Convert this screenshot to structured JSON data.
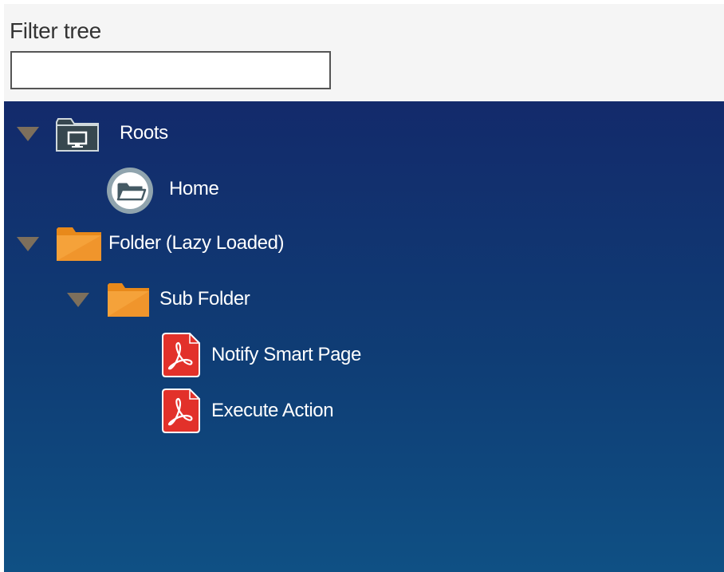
{
  "filter": {
    "label": "Filter tree",
    "value": "",
    "placeholder": ""
  },
  "tree": {
    "nodes": [
      {
        "label": "Roots",
        "icon": "computer-folder-icon",
        "expanded": true
      },
      {
        "label": "Home",
        "icon": "home-folder-icon"
      },
      {
        "label": "Folder (Lazy Loaded)",
        "icon": "folder-icon",
        "expanded": true
      },
      {
        "label": "Sub Folder",
        "icon": "folder-icon",
        "expanded": true
      },
      {
        "label": "Notify Smart Page",
        "icon": "pdf-icon"
      },
      {
        "label": "Execute Action",
        "icon": "pdf-icon"
      }
    ]
  },
  "colors": {
    "tree_bg_top": "#132a6b",
    "tree_bg_bottom": "#0f5084",
    "folder": "#f29a2e",
    "pdf": "#e2312a",
    "toggle": "#7d6f5c"
  }
}
